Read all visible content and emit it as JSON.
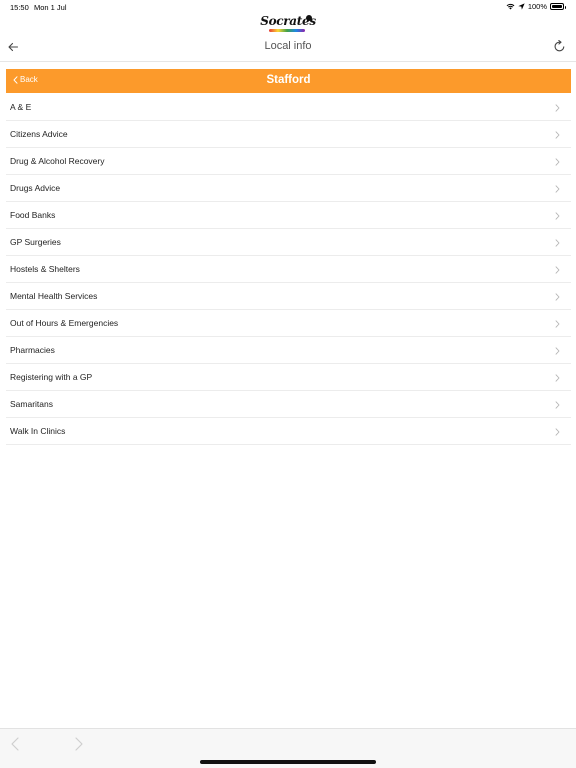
{
  "status_bar": {
    "time": "15:50",
    "date": "Mon 1 Jul",
    "battery": "100%",
    "icons": [
      "wifi-icon",
      "location-icon",
      "battery-icon"
    ]
  },
  "brand": {
    "logo_text": "Socrates"
  },
  "header": {
    "title": "Local info",
    "back_icon": "arrow-left-icon",
    "refresh_icon": "refresh-icon"
  },
  "section": {
    "back_label": "Back",
    "title": "Stafford",
    "accent_color": "#fc9a2b"
  },
  "items": [
    {
      "label": "A & E"
    },
    {
      "label": "Citizens Advice"
    },
    {
      "label": "Drug & Alcohol Recovery"
    },
    {
      "label": "Drugs Advice"
    },
    {
      "label": "Food Banks"
    },
    {
      "label": "GP Surgeries"
    },
    {
      "label": "Hostels & Shelters"
    },
    {
      "label": "Mental Health Services"
    },
    {
      "label": "Out of Hours & Emergencies"
    },
    {
      "label": "Pharmacies"
    },
    {
      "label": "Registering with a GP"
    },
    {
      "label": "Samaritans"
    },
    {
      "label": "Walk In Clinics"
    }
  ],
  "bottom_nav": {
    "prev_icon": "chevron-left-icon",
    "next_icon": "chevron-right-icon"
  }
}
